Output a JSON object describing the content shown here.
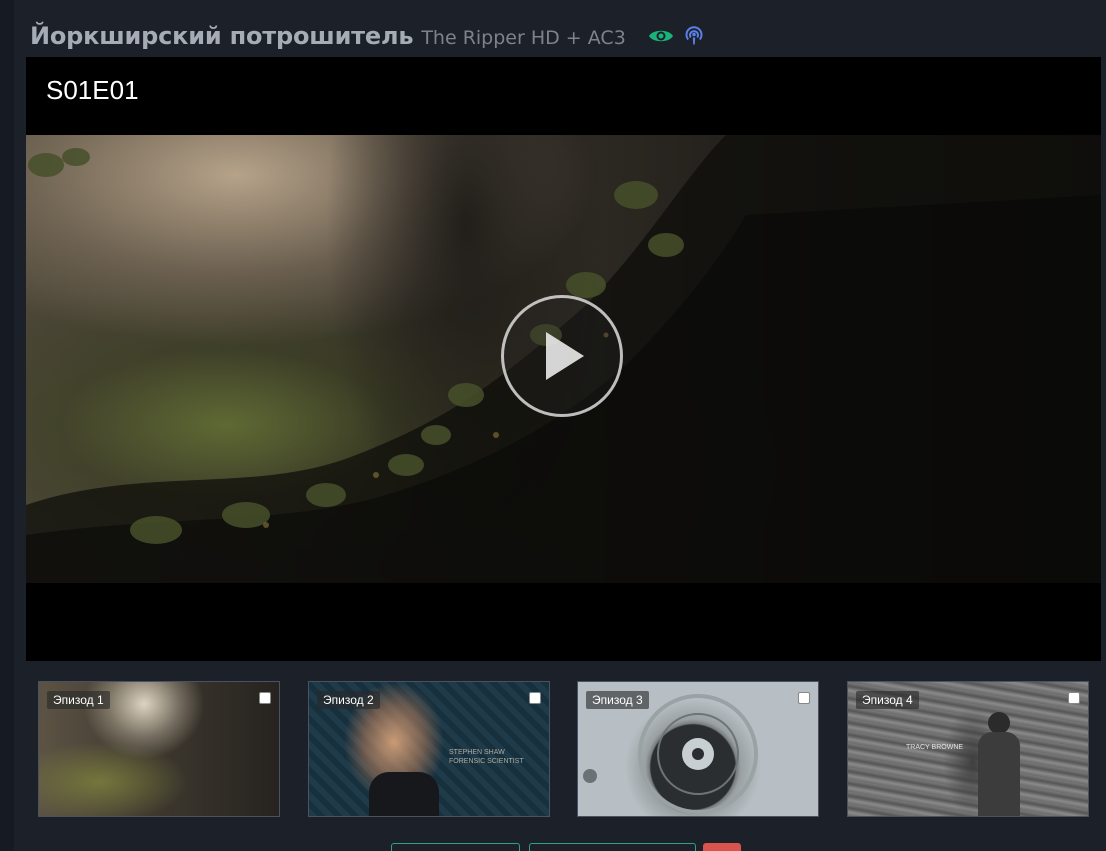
{
  "header": {
    "title": "Йоркширский потрошитель",
    "subtitle": "The Ripper HD + AC3",
    "icons": [
      "eye-icon",
      "podcast-icon"
    ],
    "eye_color": "#1bb37a",
    "podcast_color": "#5b7fe8"
  },
  "player": {
    "episode_label": "S01E01",
    "play_icon": "play-icon"
  },
  "episodes": [
    {
      "label": "Эпизод 1",
      "checked": false
    },
    {
      "label": "Эпизод 2",
      "checked": false
    },
    {
      "label": "Эпизод 3",
      "checked": false
    },
    {
      "label": "Эпизод 4",
      "checked": false
    }
  ],
  "thumbnail_captions": {
    "ep2": "STEPHEN SHAW\nFORENSIC SCIENTIST",
    "ep4": "TRACY BROWNE"
  },
  "colors": {
    "page_background": "#1b2029",
    "accent_green": "#2fa37a",
    "danger_red": "#d9534f"
  }
}
